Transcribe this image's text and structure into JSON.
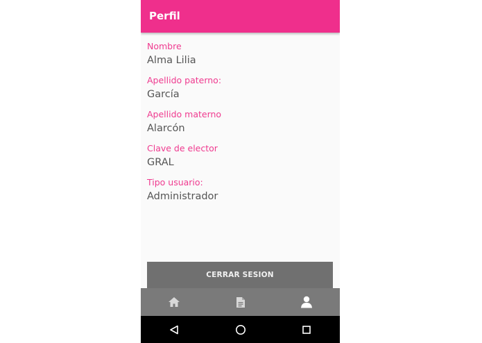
{
  "appbar": {
    "title": "Perfil",
    "color": "#ef2f8c"
  },
  "profile": {
    "fields": [
      {
        "label": "Nombre",
        "value": "Alma Lilia"
      },
      {
        "label": "Apellido paterno:",
        "value": "García"
      },
      {
        "label": "Apellido materno",
        "value": "Alarcón"
      },
      {
        "label": "Clave de elector",
        "value": "GRAL"
      },
      {
        "label": "Tipo usuario:",
        "value": "Administrador"
      }
    ]
  },
  "logout_button": {
    "label": "CERRAR SESION"
  },
  "bottom_nav": {
    "items": [
      {
        "icon": "home-icon",
        "active": false
      },
      {
        "icon": "document-icon",
        "active": false
      },
      {
        "icon": "person-icon",
        "active": true
      }
    ]
  },
  "system_nav": {
    "items": [
      {
        "icon": "back-icon"
      },
      {
        "icon": "home-circle-icon"
      },
      {
        "icon": "recents-icon"
      }
    ]
  }
}
